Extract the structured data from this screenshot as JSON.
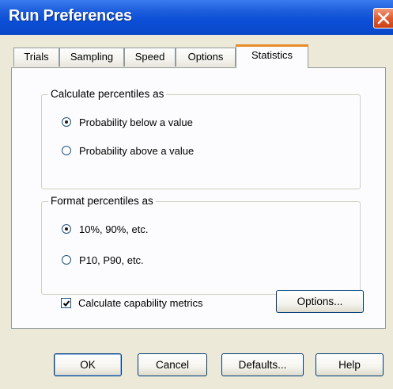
{
  "window": {
    "title": "Run Preferences",
    "close_icon": "close-icon"
  },
  "tabs": [
    {
      "label": "Trials",
      "active": false
    },
    {
      "label": "Sampling",
      "active": false
    },
    {
      "label": "Speed",
      "active": false
    },
    {
      "label": "Options",
      "active": false
    },
    {
      "label": "Statistics",
      "active": true
    }
  ],
  "calculate_group": {
    "label": "Calculate percentiles as",
    "options": [
      {
        "label": "Probability below a value",
        "selected": true
      },
      {
        "label": "Probability above a value",
        "selected": false
      }
    ]
  },
  "format_group": {
    "label": "Format percentiles as",
    "options": [
      {
        "label": "10%, 90%, etc.",
        "selected": true
      },
      {
        "label": "P10, P90, etc.",
        "selected": false
      }
    ]
  },
  "capability": {
    "checkbox_label": "Calculate capability metrics",
    "checked": true,
    "options_button": "Options..."
  },
  "buttons": {
    "ok": "OK",
    "cancel": "Cancel",
    "defaults": "Defaults...",
    "help": "Help"
  }
}
